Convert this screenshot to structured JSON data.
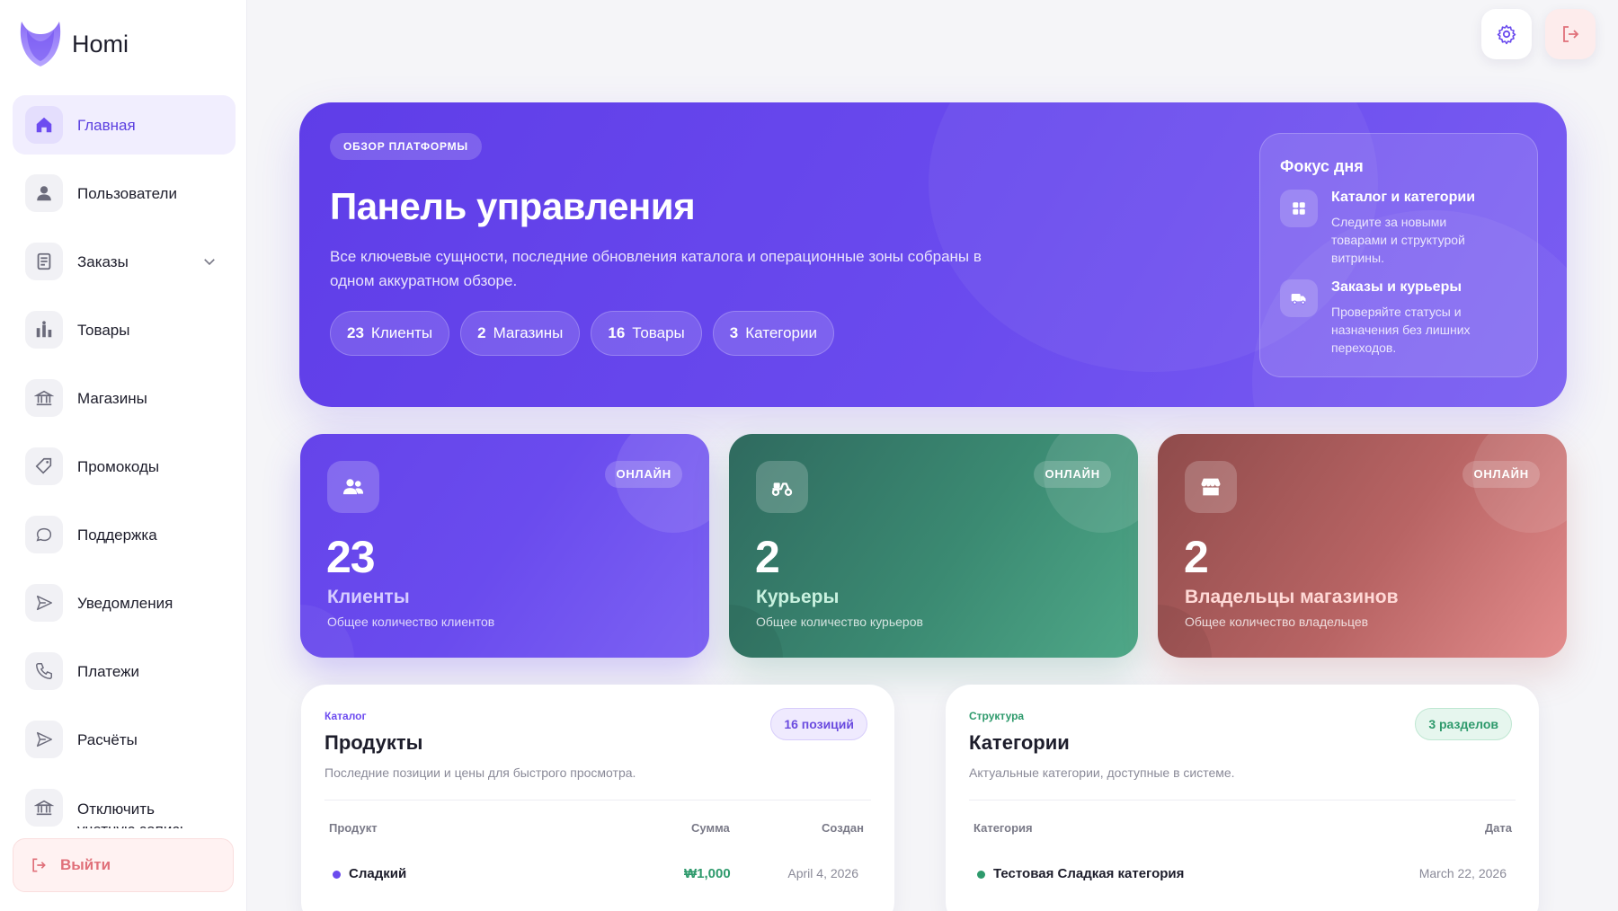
{
  "brand": {
    "name": "Homi"
  },
  "sidebar": {
    "items": [
      {
        "label": "Главная",
        "icon": "home-icon"
      },
      {
        "label": "Пользователи",
        "icon": "user-icon"
      },
      {
        "label": "Заказы",
        "icon": "orders-icon"
      },
      {
        "label": "Товары",
        "icon": "products-icon"
      },
      {
        "label": "Магазины",
        "icon": "bank-icon"
      },
      {
        "label": "Промокоды",
        "icon": "tag-icon"
      },
      {
        "label": "Поддержка",
        "icon": "chat-icon"
      },
      {
        "label": "Уведомления",
        "icon": "send-icon"
      },
      {
        "label": "Платежи",
        "icon": "phone-icon"
      },
      {
        "label": "Расчёты",
        "icon": "send-icon"
      },
      {
        "label": "Отключить учетную запись",
        "icon": "bank-icon"
      }
    ],
    "logout": "Выйти"
  },
  "hero": {
    "pill": "ОБЗОР ПЛАТФОРМЫ",
    "title": "Панель управления",
    "subtitle": "Все ключевые сущности, последние обновления каталога и операционные зоны собраны в одном аккуратном обзоре.",
    "stats": [
      {
        "num": "23",
        "label": "Клиенты"
      },
      {
        "num": "2",
        "label": "Магазины"
      },
      {
        "num": "16",
        "label": "Товары"
      },
      {
        "num": "3",
        "label": "Категории"
      }
    ],
    "focus": {
      "title": "Фокус дня",
      "items": [
        {
          "title": "Каталог и категории",
          "desc": "Следите за новыми товарами и структурой витрины."
        },
        {
          "title": "Заказы и курьеры",
          "desc": "Проверяйте статусы и назначения без лишних переходов."
        }
      ]
    }
  },
  "cards": [
    {
      "badge": "ОНЛАЙН",
      "value": "23",
      "title": "Клиенты",
      "desc": "Общее количество клиентов"
    },
    {
      "badge": "ОНЛАЙН",
      "value": "2",
      "title": "Курьеры",
      "desc": "Общее количество курьеров"
    },
    {
      "badge": "ОНЛАЙН",
      "value": "2",
      "title": "Владельцы магазинов",
      "desc": "Общее количество владельцев"
    }
  ],
  "products": {
    "kicker": "Каталог",
    "title": "Продукты",
    "subtitle": "Последние позиции и цены для быстрого просмотра.",
    "badge": "16 позиций",
    "headers": {
      "name": "Продукт",
      "sum": "Сумма",
      "date": "Создан"
    },
    "rows": [
      {
        "name": "Сладкий",
        "sum": "₩1,000",
        "date": "April 4, 2026"
      }
    ]
  },
  "categories": {
    "kicker": "Структура",
    "title": "Категории",
    "subtitle": "Актуальные категории, доступные в системе.",
    "badge": "3 разделов",
    "headers": {
      "name": "Категория",
      "date": "Дата"
    },
    "rows": [
      {
        "name": "Тестовая Сладкая категория",
        "date": "March 22, 2026"
      }
    ]
  },
  "colors": {
    "accent": "#6a4bee",
    "green": "#3b8a72",
    "red": "#b86464"
  }
}
